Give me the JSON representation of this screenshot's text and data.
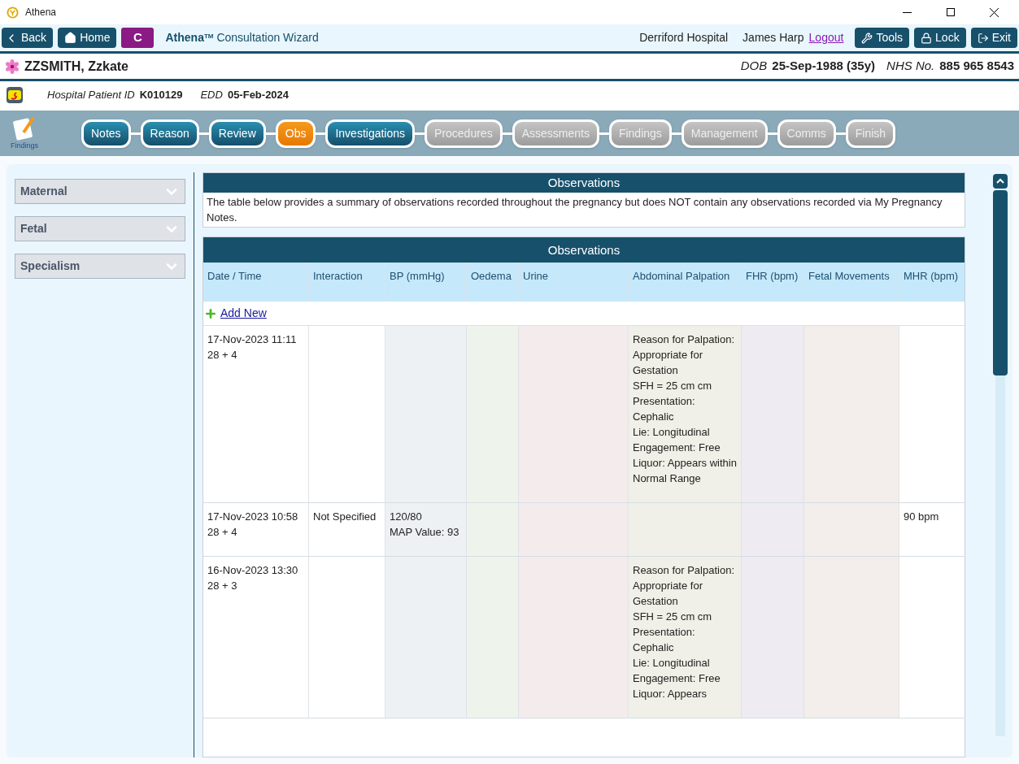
{
  "window": {
    "title": "Athena"
  },
  "toolbar": {
    "back": "Back",
    "home": "Home",
    "badge": "C",
    "app_name": "Athena",
    "app_mark": "TM",
    "app_subtitle": "Consultation Wizard",
    "location": "Derriford Hospital",
    "user": "James Harp",
    "logout": "Logout",
    "tools": "Tools",
    "lock": "Lock",
    "exit": "Exit"
  },
  "patient": {
    "name": "ZZSMITH, Zzkate",
    "dob_label": "DOB",
    "dob": "25-Sep-1988 (35y)",
    "nhs_label": "NHS No.",
    "nhs": "885 965 8543",
    "hospital_id_label": "Hospital Patient ID",
    "hospital_id": "K010129",
    "edd_label": "EDD",
    "edd": "05-Feb-2024"
  },
  "wizard": {
    "icon_label": "Findings",
    "steps": [
      {
        "label": "Notes",
        "done": true,
        "selected": false
      },
      {
        "label": "Reason",
        "done": true,
        "selected": false
      },
      {
        "label": "Review",
        "done": true,
        "selected": false
      },
      {
        "label": "Obs",
        "done": true,
        "selected": true
      },
      {
        "label": "Investigations",
        "done": true,
        "selected": false
      },
      {
        "label": "Procedures",
        "done": false,
        "selected": false
      },
      {
        "label": "Assessments",
        "done": false,
        "selected": false
      },
      {
        "label": "Findings",
        "done": false,
        "selected": false
      },
      {
        "label": "Management",
        "done": false,
        "selected": false
      },
      {
        "label": "Comms",
        "done": false,
        "selected": false
      },
      {
        "label": "Finish",
        "done": false,
        "selected": false
      }
    ]
  },
  "sidebar": {
    "items": [
      {
        "label": "Maternal",
        "expanded": false
      },
      {
        "label": "Fetal",
        "expanded": false
      },
      {
        "label": "Specialism",
        "expanded": false
      }
    ]
  },
  "info_panel": {
    "title": "Observations",
    "text": "The table below provides a summary of observations recorded throughout the pregnancy but does NOT contain any observations recorded via My Pregnancy Notes."
  },
  "table": {
    "title": "Observations",
    "add_new": "Add New",
    "columns": [
      {
        "label": "Date / Time",
        "color": "#ffffff"
      },
      {
        "label": "Interaction",
        "color": "#ffffff"
      },
      {
        "label": "BP (mmHg)",
        "color": "#edf1f4"
      },
      {
        "label": "Oedema",
        "color": "#eef4ec"
      },
      {
        "label": "Urine",
        "color": "#f4ecec"
      },
      {
        "label": "Abdominal Palpation",
        "color": "#f1f0e8"
      },
      {
        "label": "FHR (bpm)",
        "color": "#eeebf2"
      },
      {
        "label": "Fetal Movements",
        "color": "#f3eeeb"
      },
      {
        "label": "MHR (bpm)",
        "color": "#ffffff"
      }
    ],
    "rows": [
      {
        "cells": [
          [
            "17-Nov-2023 11:11",
            "28 + 4"
          ],
          [],
          [],
          [],
          [],
          [
            "Reason for Palpation: Appropriate for Gestation",
            "SFH = 25 cm cm",
            "Presentation: Cephalic",
            "Lie: Longitudinal",
            "Engagement: Free",
            "Liquor: Appears within Normal Range"
          ],
          [],
          [],
          []
        ]
      },
      {
        "cells": [
          [
            "17-Nov-2023 10:58",
            "28 + 4"
          ],
          [
            "Not Specified"
          ],
          [
            "120/80",
            "MAP Value: 93"
          ],
          [],
          [],
          [],
          [],
          [],
          [
            "90 bpm"
          ]
        ]
      },
      {
        "cells": [
          [
            "16-Nov-2023 13:30",
            "28 + 3"
          ],
          [],
          [],
          [],
          [],
          [
            "Reason for Palpation: Appropriate for Gestation",
            "SFH = 25 cm cm",
            "Presentation: Cephalic",
            "Lie: Longitudinal",
            "Engagement: Free",
            "Liquor: Appears"
          ],
          [],
          [],
          []
        ]
      }
    ]
  }
}
